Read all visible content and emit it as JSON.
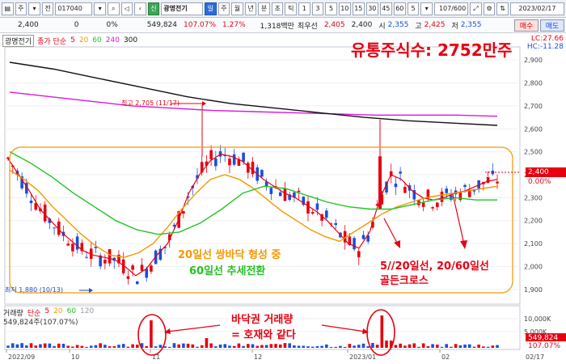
{
  "toolbar": {
    "code": "017040",
    "name": "광명전기",
    "prefix_label": "주",
    "credit_label": "신",
    "btn_jeon": "전",
    "periods": [
      "일",
      "주",
      "월",
      "년",
      "분",
      "초",
      "틱"
    ],
    "minutes": [
      "1",
      "3",
      "5",
      "10",
      "15",
      "30",
      "45",
      "60"
    ],
    "count": "5",
    "range": "107/600",
    "date": "2023/02/17"
  },
  "ticker": {
    "price": "2,400",
    "change": "0",
    "change_pct": "0%",
    "volume": "549,824",
    "vol_ratio": "107.07%",
    "turnover": "1.27%",
    "amount": "1,318백만",
    "best_bid_label": "최우선",
    "best_bid": "2,405",
    "best_ask": "2,400",
    "open_label": "시",
    "open": "2,355",
    "high_label": "고",
    "high": "2,425",
    "low_label": "저",
    "low": "2,355"
  },
  "order": {
    "buy": "매수",
    "sell": "매도"
  },
  "legend": {
    "name": "광명전기",
    "ma_label": "종가 단순",
    "ma5": "5",
    "ma20": "20",
    "ma60": "60",
    "ma240": "240",
    "ma300": "300"
  },
  "volume_legend": {
    "label": "거래량",
    "type": "단순",
    "ma5": "5",
    "ma20": "20",
    "ma60": "60",
    "ma120": "120",
    "total": "549,824주(107.07%)"
  },
  "annotations": {
    "title": "유통주식수: 2752만주",
    "high_label": "최고 2,705 (11/17)",
    "low_label": "최저 1,880 (10/13)",
    "pattern1": "20일선 쌍바닥 형성 중",
    "pattern2": "60일선 추세전환",
    "cross1": "5//20일선, 20/60일선",
    "cross2": "골든크로스",
    "vol1": "바닥권 거래량",
    "vol2": "= 호재와 같다"
  },
  "side": {
    "lc": "LC:27.66",
    "hc": "HC:-11.28"
  },
  "price_tags": {
    "current": "2,400",
    "pct": "0.00%",
    "vol": "549,824",
    "vol_pct": "107.07%"
  },
  "colors": {
    "up": "#e60012",
    "down": "#1b4fd8",
    "ma5": "#e60012",
    "ma20": "#f39800",
    "ma60": "#22c322",
    "ma240": "#d81ad8",
    "ma300": "#111111"
  },
  "chart_data": {
    "type": "candlestick",
    "y_axis": [
      "2,900",
      "2,800",
      "2,700",
      "2,600",
      "2,500",
      "2,400",
      "2,300",
      "2,200",
      "2,100",
      "2,000",
      "1,900"
    ],
    "ylim": [
      1850,
      2950
    ],
    "volume_axis": [
      "10,000K",
      "5,000K"
    ],
    "x_labels": [
      "2022/09",
      "10",
      "11",
      "12",
      "2023/01",
      "02",
      "02/17"
    ],
    "current_price": 2400,
    "series": [
      {
        "name": "5",
        "color": "#e60012",
        "values": [
          2470,
          2400,
          2330,
          2250,
          2200,
          2150,
          2110,
          2070,
          2050,
          2040,
          2030,
          2000,
          1960,
          1990,
          2050,
          2100,
          2200,
          2320,
          2400,
          2460,
          2490,
          2480,
          2460,
          2420,
          2380,
          2350,
          2320,
          2300,
          2270,
          2240,
          2200,
          2150,
          2100,
          2080,
          2150,
          2300,
          2400,
          2380,
          2330,
          2300,
          2290,
          2300,
          2320,
          2330,
          2350,
          2370,
          2380
        ]
      },
      {
        "name": "20",
        "color": "#f39800",
        "values": [
          2420,
          2380,
          2330,
          2260,
          2200,
          2140,
          2090,
          2050,
          2040,
          2060,
          2100,
          2170,
          2250,
          2320,
          2380,
          2400,
          2380,
          2340,
          2290,
          2240,
          2200,
          2160,
          2130,
          2110,
          2150,
          2190,
          2230,
          2260,
          2280,
          2300,
          2310,
          2320,
          2330,
          2340,
          2350
        ]
      },
      {
        "name": "60",
        "color": "#22c322",
        "values": [
          2500,
          2450,
          2390,
          2320,
          2260,
          2200,
          2160,
          2140,
          2150,
          2190,
          2250,
          2320,
          2350,
          2340,
          2310,
          2280,
          2260,
          2250,
          2250,
          2270,
          2290,
          2300,
          2290,
          2290
        ]
      },
      {
        "name": "240",
        "color": "#d81ad8",
        "values": [
          2760,
          2740,
          2720,
          2700,
          2690,
          2680,
          2675,
          2670,
          2665,
          2660,
          2660,
          2660,
          2655
        ]
      },
      {
        "name": "300",
        "color": "#111111",
        "values": [
          2890,
          2860,
          2820,
          2780,
          2740,
          2710,
          2690,
          2670,
          2650,
          2635,
          2625,
          2615
        ]
      }
    ],
    "volume_spikes": [
      {
        "x": "11",
        "value": "large"
      },
      {
        "x": "2023/01",
        "value": "large"
      }
    ]
  }
}
